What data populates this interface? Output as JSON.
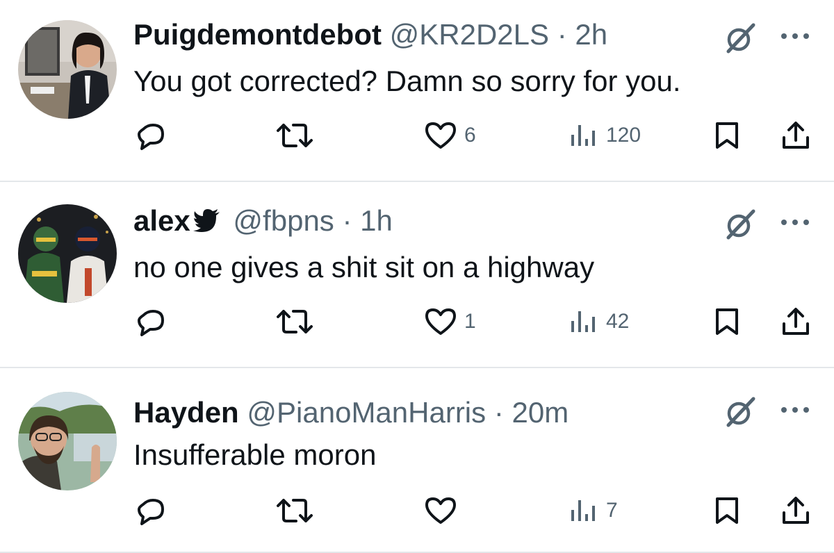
{
  "tweets": [
    {
      "name": "Puigdemontdebot",
      "handle": "@KR2D2LS",
      "separator": "·",
      "time": "2h",
      "verified": false,
      "text": "You got corrected? Damn so sorry for you.",
      "likes": "6",
      "views": "120"
    },
    {
      "name": "alex",
      "handle": "@fbpns",
      "separator": "·",
      "time": "1h",
      "verified": true,
      "text": "no one gives a shit sit on a highway",
      "likes": "1",
      "views": "42"
    },
    {
      "name": "Hayden",
      "handle": "@PianoManHarris",
      "separator": "·",
      "time": "20m",
      "verified": false,
      "text": "Insufferable moron",
      "likes": "",
      "views": "7"
    }
  ],
  "colors": {
    "text": "#0f1419",
    "secondary": "#536471",
    "divider": "#e4e7ea",
    "background": "#ffffff"
  },
  "icons": [
    "reply-icon",
    "retweet-icon",
    "like-icon",
    "views-icon",
    "bookmark-icon",
    "share-icon",
    "grok-icon",
    "more-icon",
    "bird-icon"
  ]
}
